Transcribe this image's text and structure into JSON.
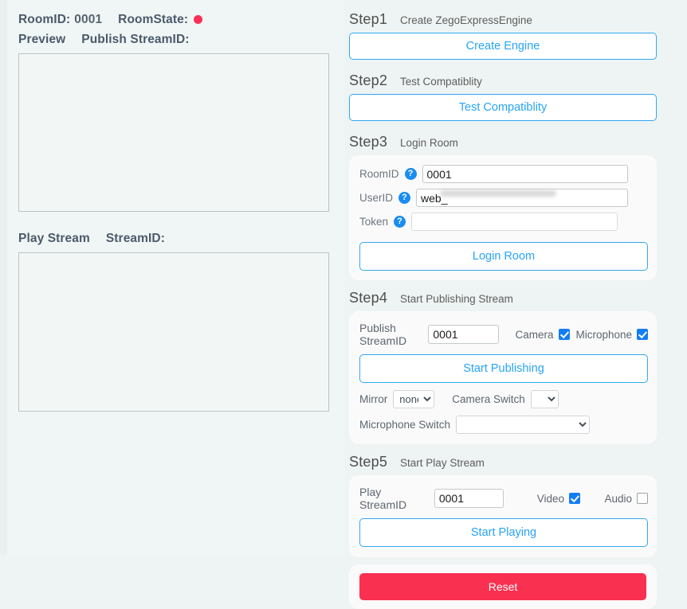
{
  "left": {
    "room_id_label": "RoomID:",
    "room_id_value": "0001",
    "room_state_label": "RoomState:",
    "room_state_color": "#fa2f55",
    "preview_label": "Preview",
    "publish_stream_id_label": "Publish StreamID:",
    "play_stream_label": "Play Stream",
    "stream_id_label": "StreamID:"
  },
  "steps": {
    "step1": {
      "num": "Step1",
      "desc": "Create ZegoExpressEngine",
      "button": "Create Engine"
    },
    "step2": {
      "num": "Step2",
      "desc": "Test Compatiblity",
      "button": "Test Compatiblity"
    },
    "step3": {
      "num": "Step3",
      "desc": "Login Room",
      "fields": {
        "room_id_label": "RoomID",
        "room_id_value": "0001",
        "user_id_label": "UserID",
        "user_id_value": "web_",
        "token_label": "Token",
        "token_value": "",
        "help_glyph": "?"
      },
      "button": "Login Room"
    },
    "step4": {
      "num": "Step4",
      "desc": "Start Publishing Stream",
      "publish_stream_id_label": "Publish StreamID",
      "publish_stream_id_value": "0001",
      "camera_label": "Camera",
      "camera_checked": true,
      "microphone_label": "Microphone",
      "microphone_checked": true,
      "button": "Start Publishing",
      "mirror_label": "Mirror",
      "mirror_value": "none",
      "camera_switch_label": "Camera Switch",
      "camera_switch_value": "",
      "microphone_switch_label": "Microphone Switch",
      "microphone_switch_value": ""
    },
    "step5": {
      "num": "Step5",
      "desc": "Start Play Stream",
      "play_stream_id_label": "Play StreamID",
      "play_stream_id_value": "0001",
      "video_label": "Video",
      "video_checked": true,
      "audio_label": "Audio",
      "audio_checked": false,
      "button": "Start Playing"
    }
  },
  "reset": {
    "label": "Reset",
    "color": "#f9304f"
  },
  "theme": {
    "accent_blue": "#27a4f5",
    "page_bg": "#eef4f3",
    "card_bg": "#fbfafa"
  }
}
